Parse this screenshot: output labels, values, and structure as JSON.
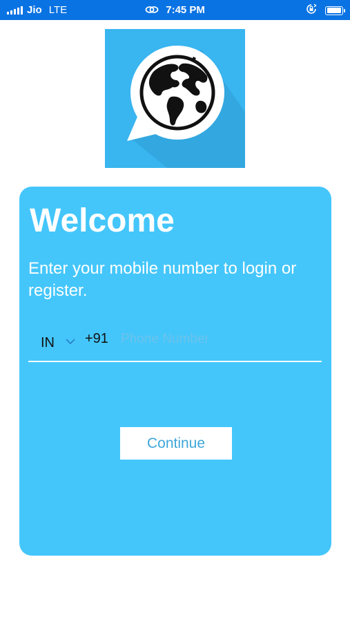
{
  "status_bar": {
    "carrier": "Jio",
    "network": "LTE",
    "time": "7:45 PM",
    "icons": [
      "signal-icon",
      "link-icon",
      "orientation-lock-icon",
      "battery-icon"
    ],
    "color": "#0a73e3"
  },
  "logo": {
    "icon": "globe-chat-bubble-icon",
    "background": "#39b5f0"
  },
  "login": {
    "title": "Welcome",
    "subtitle": "Enter your mobile number to login or register.",
    "country_code": "IN",
    "dial_code": "+91",
    "phone_placeholder": "Phone Number",
    "phone_value": "",
    "continue_label": "Continue",
    "card_color": "#44c6fb"
  }
}
